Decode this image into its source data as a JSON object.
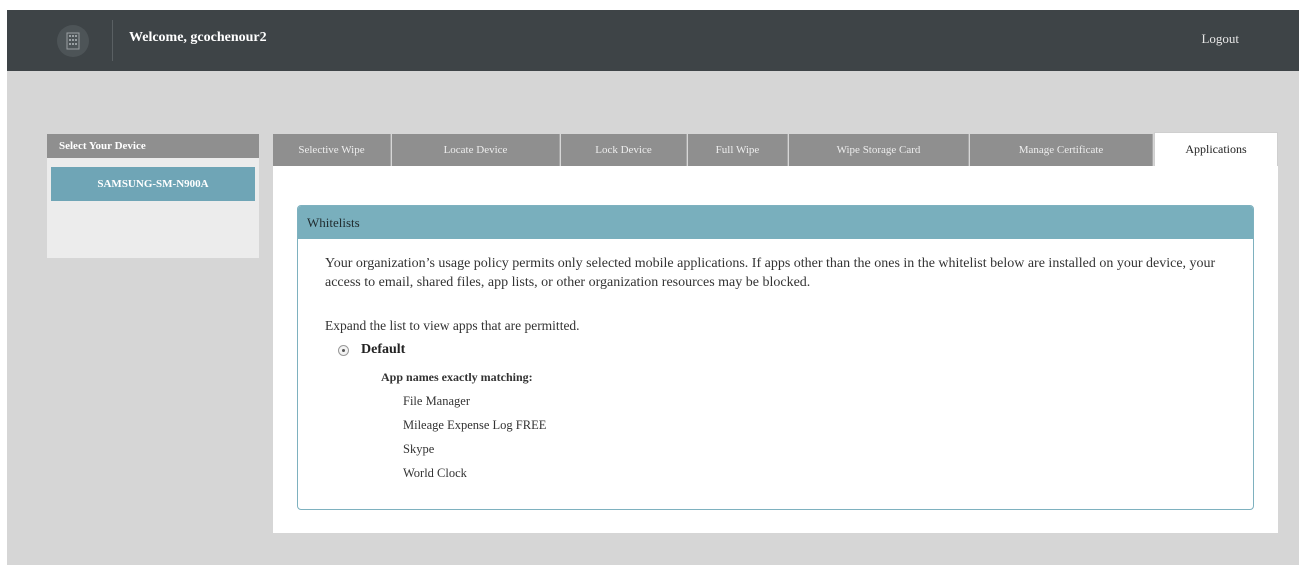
{
  "header": {
    "welcome": "Welcome, gcochenour2",
    "logout": "Logout"
  },
  "sidebar": {
    "title": "Select Your Device",
    "device": "SAMSUNG-SM-N900A"
  },
  "tabs": [
    {
      "label": "Selective Wipe"
    },
    {
      "label": "Locate Device"
    },
    {
      "label": "Lock Device"
    },
    {
      "label": "Full Wipe"
    },
    {
      "label": "Wipe Storage Card"
    },
    {
      "label": "Manage Certificate"
    },
    {
      "label": "Applications"
    }
  ],
  "panel": {
    "title": "Whitelists",
    "policy": "Your organization’s usage policy permits only selected mobile applications. If apps other than the ones in the whitelist below are installed on your device, your access to email, shared files, app lists, or other organization resources may be blocked.",
    "expand": "Expand the list to view apps that are permitted.",
    "group": "Default",
    "match_label": "App names exactly matching:",
    "apps": [
      "File Manager",
      "Mileage Expense Log FREE",
      "Skype",
      "World Clock"
    ]
  },
  "colors": {
    "topbar": "#3e4447",
    "tab_inactive": "#8f8f8f",
    "accent": "#79afbd",
    "device_button": "#6fa5b6"
  },
  "icons": {
    "logo": "building-icon",
    "expand": "radio-expand-icon"
  }
}
